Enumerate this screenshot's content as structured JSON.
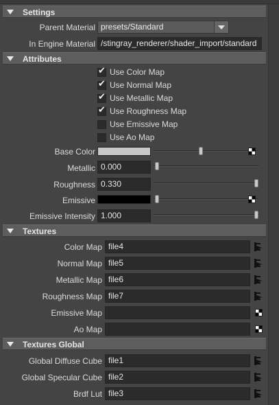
{
  "sections": {
    "settings": "Settings",
    "attributes": "Attributes",
    "textures": "Textures",
    "textures_global": "Textures Global"
  },
  "settings": {
    "parent_material_label": "Parent Material",
    "parent_material_value": "presets/Standard",
    "in_engine_label": "In Engine Material",
    "in_engine_value": "/stingray_renderer/shader_import/standard"
  },
  "checkboxes": [
    {
      "label": "Use Color Map",
      "checked": true
    },
    {
      "label": "Use Normal Map",
      "checked": true
    },
    {
      "label": "Use Metallic Map",
      "checked": true
    },
    {
      "label": "Use Roughness Map",
      "checked": true
    },
    {
      "label": "Use Emissive Map",
      "checked": false
    },
    {
      "label": "Use Ao Map",
      "checked": false
    }
  ],
  "attributes": {
    "base_color_label": "Base Color",
    "base_color_hex": "#c8c8c8",
    "base_color_slider": 0.3,
    "metallic_label": "Metallic",
    "metallic_value": "0.000",
    "roughness_label": "Roughness",
    "roughness_value": "0.330",
    "emissive_label": "Emissive",
    "emissive_hex": "#000000",
    "emissive_intensity_label": "Emissive Intensity",
    "emissive_intensity_value": "1.000"
  },
  "textures": [
    {
      "label": "Color Map",
      "value": "file4",
      "connected": true
    },
    {
      "label": "Normal Map",
      "value": "file5",
      "connected": true
    },
    {
      "label": "Metallic Map",
      "value": "file6",
      "connected": true
    },
    {
      "label": "Roughness Map",
      "value": "file7",
      "connected": true
    },
    {
      "label": "Emissive Map",
      "value": "",
      "connected": false
    },
    {
      "label": "Ao Map",
      "value": "",
      "connected": false
    }
  ],
  "textures_global": [
    {
      "label": "Global Diffuse Cube",
      "value": "file1"
    },
    {
      "label": "Global Specular Cube",
      "value": "file2"
    },
    {
      "label": "Brdf Lut",
      "value": "file3"
    }
  ]
}
